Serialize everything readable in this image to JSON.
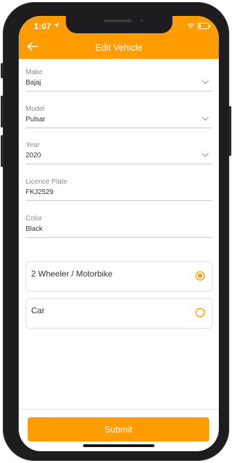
{
  "status_bar": {
    "time": "1:07",
    "location_icon": "location-arrow-icon",
    "signal_icon": "signal-dots-icon",
    "wifi_icon": "wifi-icon",
    "battery_icon": "battery-low-icon"
  },
  "header": {
    "title": "Edit Vehicle",
    "back_icon": "back-arrow-icon",
    "background": "#ff9c00"
  },
  "form": {
    "make": {
      "label": "Make",
      "value": "Bajaj",
      "icon": "chevron-down-icon"
    },
    "model": {
      "label": "Model",
      "value": "Pulsar",
      "icon": "chevron-down-icon"
    },
    "year": {
      "label": "Year",
      "value": "2020",
      "icon": "chevron-down-icon"
    },
    "licence_plate": {
      "label": "Licence Plate",
      "value": "FKJ2529"
    },
    "color": {
      "label": "Color",
      "value": "Black"
    }
  },
  "vehicle_type": {
    "options": [
      {
        "label": "2 Wheeler / Motorbike",
        "selected": true
      },
      {
        "label": "Car",
        "selected": false
      }
    ]
  },
  "actions": {
    "submit_label": "Submit"
  },
  "colors": {
    "accent": "#ff9c00"
  }
}
